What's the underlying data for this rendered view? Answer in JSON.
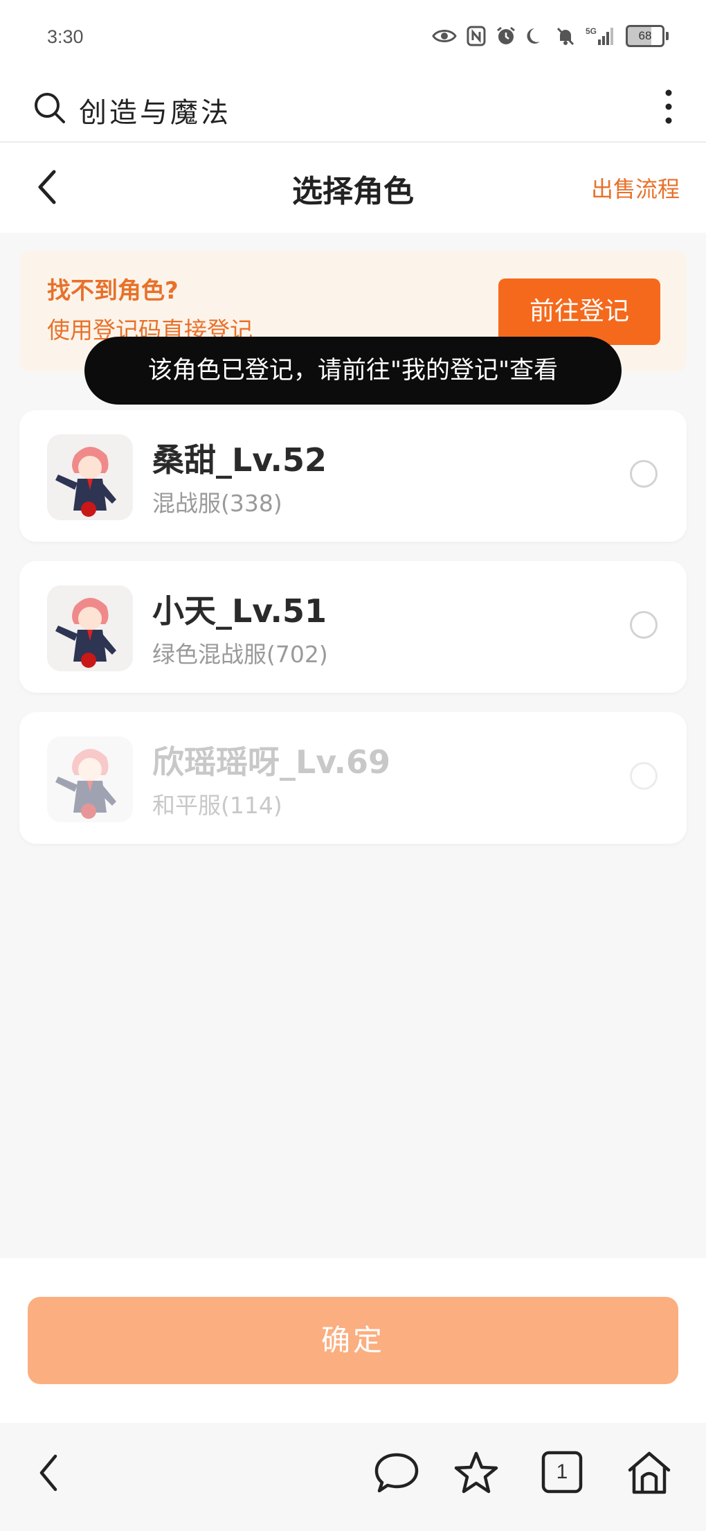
{
  "status_bar": {
    "time": "3:30",
    "network": "5G",
    "battery": "68"
  },
  "search": {
    "query": "创造与魔法"
  },
  "navbar": {
    "title": "选择角色",
    "right_link": "出售流程"
  },
  "notice": {
    "title": "找不到角色?",
    "subtitle": "使用登记码直接登记",
    "button": "前往登记"
  },
  "toast": "该角色已登记，请前往\"我的登记\"查看",
  "characters": [
    {
      "name": "桑甜_Lv.52",
      "server": "混战服(338)",
      "disabled": false
    },
    {
      "name": "小天_Lv.51",
      "server": "绿色混战服(702)",
      "disabled": false
    },
    {
      "name": "欣瑶瑶呀_Lv.69",
      "server": "和平服(114)",
      "disabled": true
    }
  ],
  "confirm_button": "确定",
  "browser_bar": {
    "tab_count": "1"
  },
  "colors": {
    "accent": "#f5691c",
    "accent_text": "#e8712a",
    "confirm_disabled": "#fbae80",
    "notice_bg": "#fcf4eb"
  }
}
